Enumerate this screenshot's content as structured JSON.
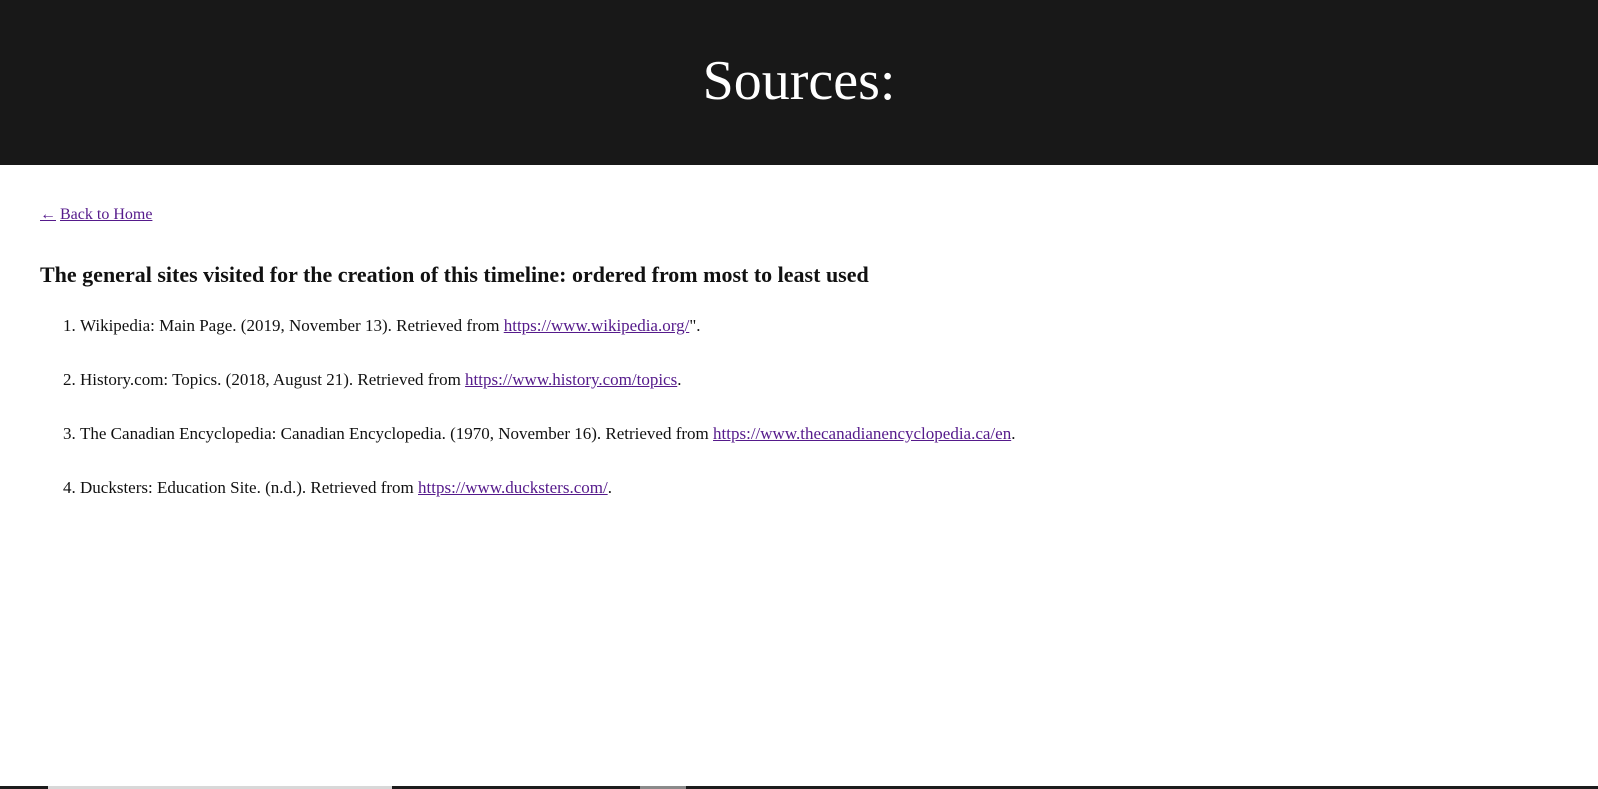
{
  "header": {
    "title": "Sources:"
  },
  "nav": {
    "back_arrow": "←",
    "back_label": "Back to Home"
  },
  "main": {
    "subtitle": "The general sites visited for the creation of this timeline: ordered from most to least used",
    "sources": [
      {
        "text": "Wikipedia: Main Page. (2019, November 13). Retrieved from ",
        "url": "https://www.wikipedia.org/",
        "suffix": "\"."
      },
      {
        "text": "History.com: Topics. (2018, August 21). Retrieved from ",
        "url": "https://www.history.com/topics",
        "suffix": "."
      },
      {
        "text": "The Canadian Encyclopedia: Canadian Encyclopedia. (1970, November 16). Retrieved from ",
        "url": "https://www.thecanadianencyclopedia.ca/en",
        "suffix": "."
      },
      {
        "text": "Ducksters: Education Site. (n.d.). Retrieved from ",
        "url": "https://www.ducksters.com/",
        "suffix": "."
      }
    ]
  },
  "colors": {
    "header_bg": "#181818",
    "header_text": "#ffffff",
    "link": "#551a8b",
    "body_text": "#111111"
  }
}
